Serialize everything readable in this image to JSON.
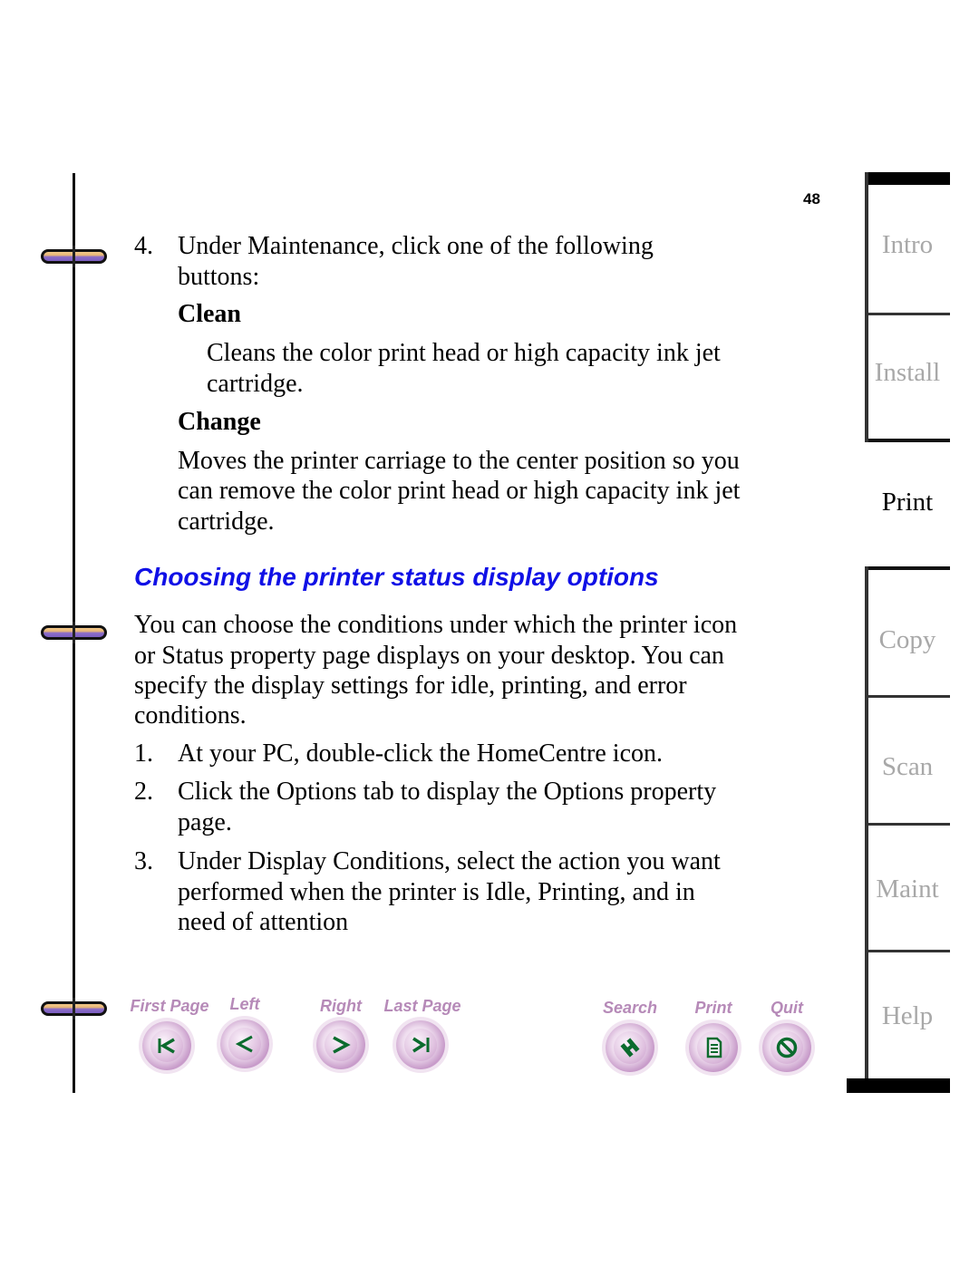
{
  "page_number": "48",
  "content": {
    "step4_num": "4.",
    "step4_text_l1": "Under Maintenance, click one of the following",
    "step4_text_l2": "buttons:",
    "clean_title": "Clean",
    "clean_desc_l1": "Cleans the color print head or high capacity ink jet",
    "clean_desc_l2": "cartridge.",
    "change_title": "Change",
    "change_desc_l1": "Moves the printer carriage to the center position so you",
    "change_desc_l2": "can remove the color print head or high capacity ink jet",
    "change_desc_l3": "cartridge.",
    "section_heading": "Choosing the printer status display options",
    "intro_l1": "You can choose the conditions under which the printer icon",
    "intro_l2": "or Status property page displays on your desktop. You can",
    "intro_l3": "specify the display settings for idle, printing, and error",
    "intro_l4": "conditions.",
    "steps": [
      {
        "num": "1.",
        "lines": [
          "At your PC, double-click the HomeCentre icon."
        ]
      },
      {
        "num": "2.",
        "lines": [
          "Click the Options tab to display the Options property",
          "page."
        ]
      },
      {
        "num": "3.",
        "lines": [
          "Under Display Conditions, select the action you want",
          "performed when the printer is Idle, Printing, and in",
          "need of attention"
        ]
      }
    ]
  },
  "nav": {
    "first_page": {
      "label": "First Page",
      "icon": "first-page-icon"
    },
    "left": {
      "label": "Left",
      "icon": "left-arrow-icon"
    },
    "right": {
      "label": "Right",
      "icon": "right-arrow-icon"
    },
    "last_page": {
      "label": "Last Page",
      "icon": "last-page-icon"
    },
    "search": {
      "label": "Search",
      "icon": "search-binoculars-icon"
    },
    "print": {
      "label": "Print",
      "icon": "print-document-icon"
    },
    "quit": {
      "label": "Quit",
      "icon": "quit-prohibited-icon"
    }
  },
  "tabs": [
    {
      "label": "Intro",
      "active": false
    },
    {
      "label": "Install",
      "active": false
    },
    {
      "label": "Print",
      "active": true
    },
    {
      "label": "Copy",
      "active": false
    },
    {
      "label": "Scan",
      "active": false
    },
    {
      "label": "Maint",
      "active": false
    },
    {
      "label": "Help",
      "active": false
    }
  ],
  "colors": {
    "heading": "#1010e6",
    "nav_label": "#b68ab8",
    "nav_icon": "#0b6b2e",
    "tab_inactive": "#a8a8a8"
  }
}
